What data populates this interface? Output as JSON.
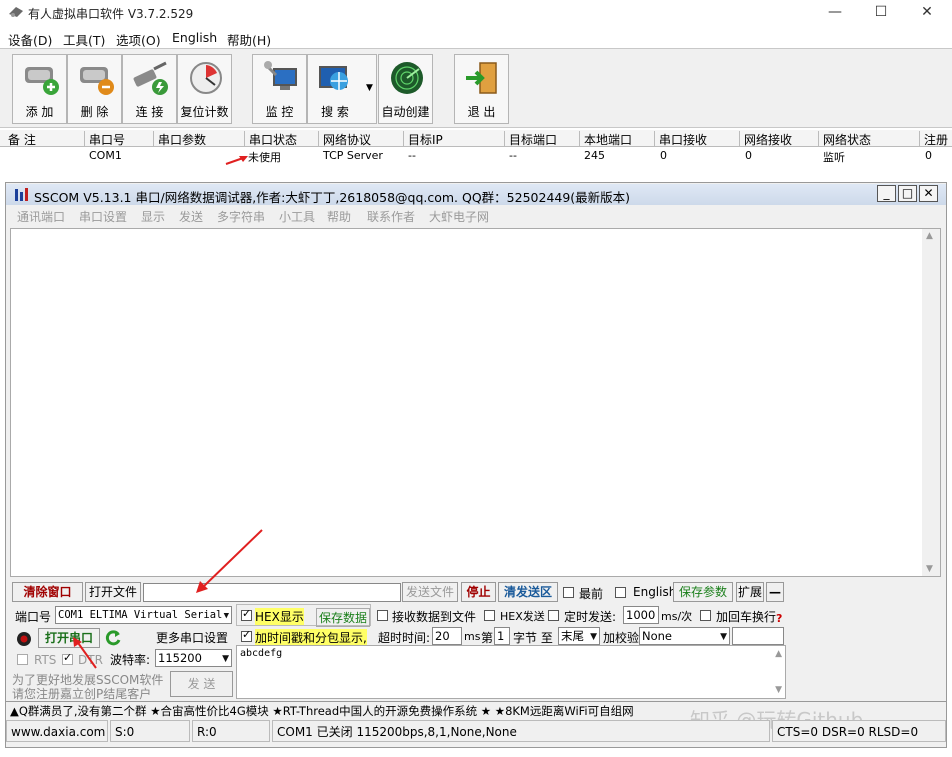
{
  "window": {
    "title": "有人虚拟串口软件 V3.7.2.529"
  },
  "menu": [
    "设备(D)",
    "工具(T)",
    "选项(O)",
    "English",
    "帮助(H)"
  ],
  "toolbar": [
    {
      "label": "添 加",
      "icon": "serial-add-icon"
    },
    {
      "label": "删 除",
      "icon": "serial-delete-icon"
    },
    {
      "label": "连 接",
      "icon": "connect-icon"
    },
    {
      "label": "复位计数",
      "icon": "reset-count-icon"
    },
    {
      "label": "监 控",
      "icon": "monitor-icon"
    },
    {
      "label": "搜 索",
      "icon": "search-globe-icon"
    },
    {
      "label": "自动创建",
      "icon": "radar-icon"
    },
    {
      "label": "退 出",
      "icon": "exit-door-icon"
    }
  ],
  "port_table": {
    "headers": [
      "备 注",
      "串口号",
      "串口参数",
      "串口状态",
      "网络协议",
      "目标IP",
      "目标端口",
      "本地端口",
      "串口接收",
      "网络接收",
      "网络状态",
      "注册"
    ],
    "row": [
      "",
      "COM1",
      "",
      "未使用",
      "TCP Server",
      "--",
      "--",
      "245",
      "0",
      "0",
      "监听",
      "0"
    ]
  },
  "sscom": {
    "title": "SSCOM V5.13.1 串口/网络数据调试器,作者:大虾丁丁,2618058@qq.com. QQ群：52502449(最新版本)",
    "menu": [
      "通讯端口",
      "串口设置",
      "显示",
      "发送",
      "多字符串",
      "小工具",
      "帮助",
      "联系作者",
      "大虾电子网"
    ],
    "row1": {
      "clear_window": "清除窗口",
      "open_file": "打开文件",
      "send_file": "发送文件",
      "stop": "停止",
      "clear_send": "清发送区",
      "topmost": "最前",
      "english": "English",
      "save_params": "保存参数",
      "expand": "扩展",
      "minus": "—"
    },
    "port_label": "端口号",
    "port_value": "COM1 ELTIMA Virtual Serial",
    "hex_display": "HEX显示",
    "save_data": "保存数据",
    "recv_to_file": "接收数据到文件",
    "hex_send": "HEX发送",
    "timed_send": "定时发送:",
    "interval": "1000",
    "interval_unit": "ms/次",
    "add_crlf": "加回车换行",
    "open_port": "打开串口",
    "more_settings": "更多串口设置",
    "timestamp": "加时间戳和分包显示,",
    "timeout_label": "超时时间:",
    "timeout_value": "20",
    "timeout_unit": "ms",
    "nth_label": "第",
    "nth_value": "1",
    "byte_label": "字节 至",
    "end_value": "末尾",
    "checksum_label": "加校验",
    "checksum_value": "None",
    "rts": "RTS",
    "dtr": "DTR",
    "baud_label": "波特率:",
    "baud_value": "115200",
    "send_text": "abcdefg",
    "send_button": "发 送",
    "promo1": "为了更好地发展SSCOM软件",
    "promo2": "请您注册嘉立创P结尾客户",
    "marquee": "▲Q群满员了,没有第二个群 ★合宙高性价比4G模块 ★RT-Thread中国人的开源免费操作系统 ★ ★8KM远距离WiFi可自组网",
    "status": [
      "www.daxia.com",
      "S:0",
      "R:0",
      "COM1 已关闭  115200bps,8,1,None,None",
      "CTS=0 DSR=0 RLSD=0"
    ]
  },
  "watermark": "知乎 @玩转Github"
}
